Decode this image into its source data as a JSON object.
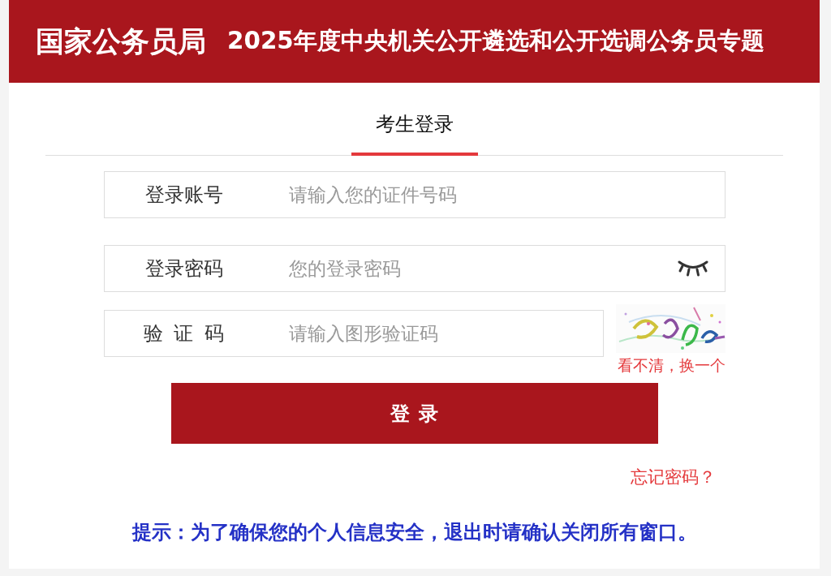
{
  "header": {
    "logo": "国家公务员局",
    "title": "2025年度中央机关公开遴选和公开选调公务员专题"
  },
  "tabs": [
    {
      "label": "考生登录",
      "selected": true
    }
  ],
  "form": {
    "fields": [
      {
        "kind": "text",
        "label": "登录账号",
        "placeholder": "请输入您的证件号码"
      },
      {
        "kind": "password",
        "label": "登录密码",
        "placeholder": "您的登录密码",
        "revealed": false
      },
      {
        "kind": "captcha",
        "label": "验 证 码",
        "placeholder": "请输入图形验证码",
        "refresh_link": "看不清，换一个"
      }
    ],
    "submit_button": "登 录",
    "forgot_link": "忘记密码？"
  },
  "notice": "提示：为了确保您的个人信息安全，退出时请确认关闭所有窗口。"
}
